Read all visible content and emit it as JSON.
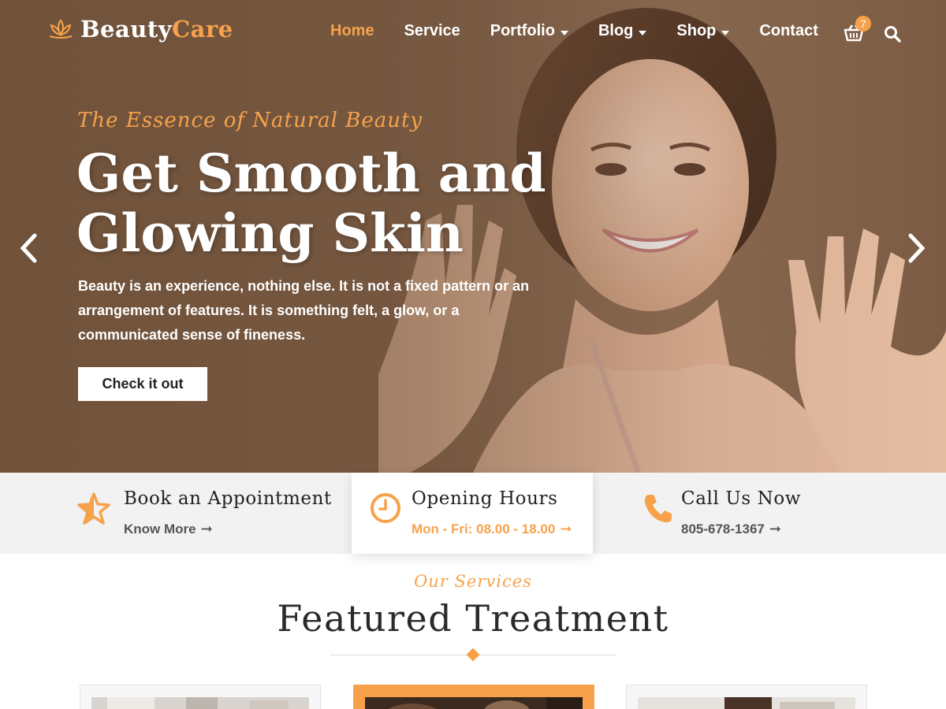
{
  "brand": {
    "name_part1": "Beauty",
    "name_part2": "Care",
    "accent": "#f7a24b"
  },
  "nav": {
    "items": [
      {
        "label": "Home",
        "active": true,
        "dropdown": false
      },
      {
        "label": "Service",
        "active": false,
        "dropdown": false
      },
      {
        "label": "Portfolio",
        "active": false,
        "dropdown": true
      },
      {
        "label": "Blog",
        "active": false,
        "dropdown": true
      },
      {
        "label": "Shop",
        "active": false,
        "dropdown": true
      },
      {
        "label": "Contact",
        "active": false,
        "dropdown": false
      }
    ],
    "cart_count": "7",
    "cart_icon": "basket-icon",
    "search_icon": "search-icon"
  },
  "hero": {
    "tagline": "The Essence of Natural Beauty",
    "title_line1": "Get Smooth and",
    "title_line2": "Glowing Skin",
    "description": "Beauty is an experience, nothing else. It is not a fixed pattern or an arrangement of features. It is something felt, a glow, or a communicated sense of fineness.",
    "button_label": "Check it out",
    "prev_icon": "chevron-left-icon",
    "next_icon": "chevron-right-icon"
  },
  "info": [
    {
      "title": "Book an Appointment",
      "sub": "Know More",
      "icon": "star-icon"
    },
    {
      "title": "Opening Hours",
      "sub": "Mon - Fri: 08.00 - 18.00",
      "icon": "clock-icon"
    },
    {
      "title": "Call Us Now",
      "sub": "805-678-1367",
      "icon": "phone-icon"
    }
  ],
  "services": {
    "kicker": "Our Services",
    "title": "Featured Treatment"
  }
}
